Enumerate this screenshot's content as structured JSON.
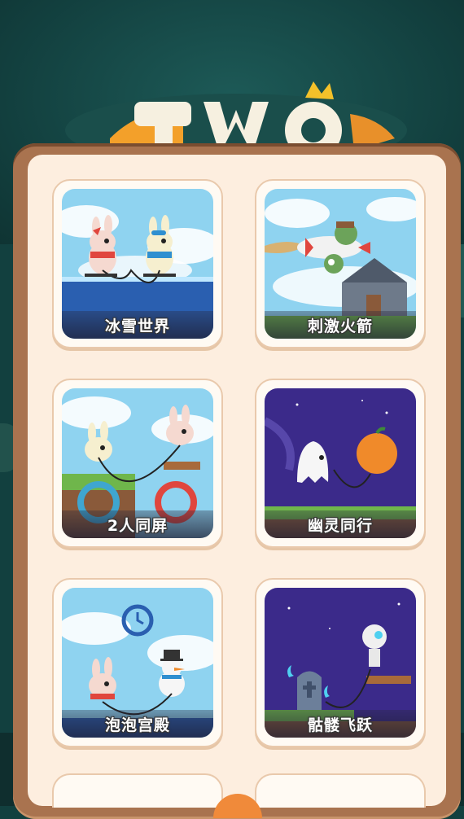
{
  "levels": [
    {
      "label": "冰雪世界",
      "theme": "ice",
      "bg": "#8fd3f0"
    },
    {
      "label": "刺激火箭",
      "theme": "rocket",
      "bg": "#8fd3f0"
    },
    {
      "label": "2人同屏",
      "theme": "two-player",
      "bg": "#8fd3f0"
    },
    {
      "label": "幽灵同行",
      "theme": "ghost",
      "bg": "#3b2a8a"
    },
    {
      "label": "泡泡宫殿",
      "theme": "bubble",
      "bg": "#8fd3f0"
    },
    {
      "label": "骷髅飞跃",
      "theme": "skeleton",
      "bg": "#3b2a8a"
    }
  ],
  "colors": {
    "panel_frame": "#a9734f",
    "panel_inner": "#fdeedf",
    "card": "#fffaf3",
    "accent": "#f08a3a"
  }
}
